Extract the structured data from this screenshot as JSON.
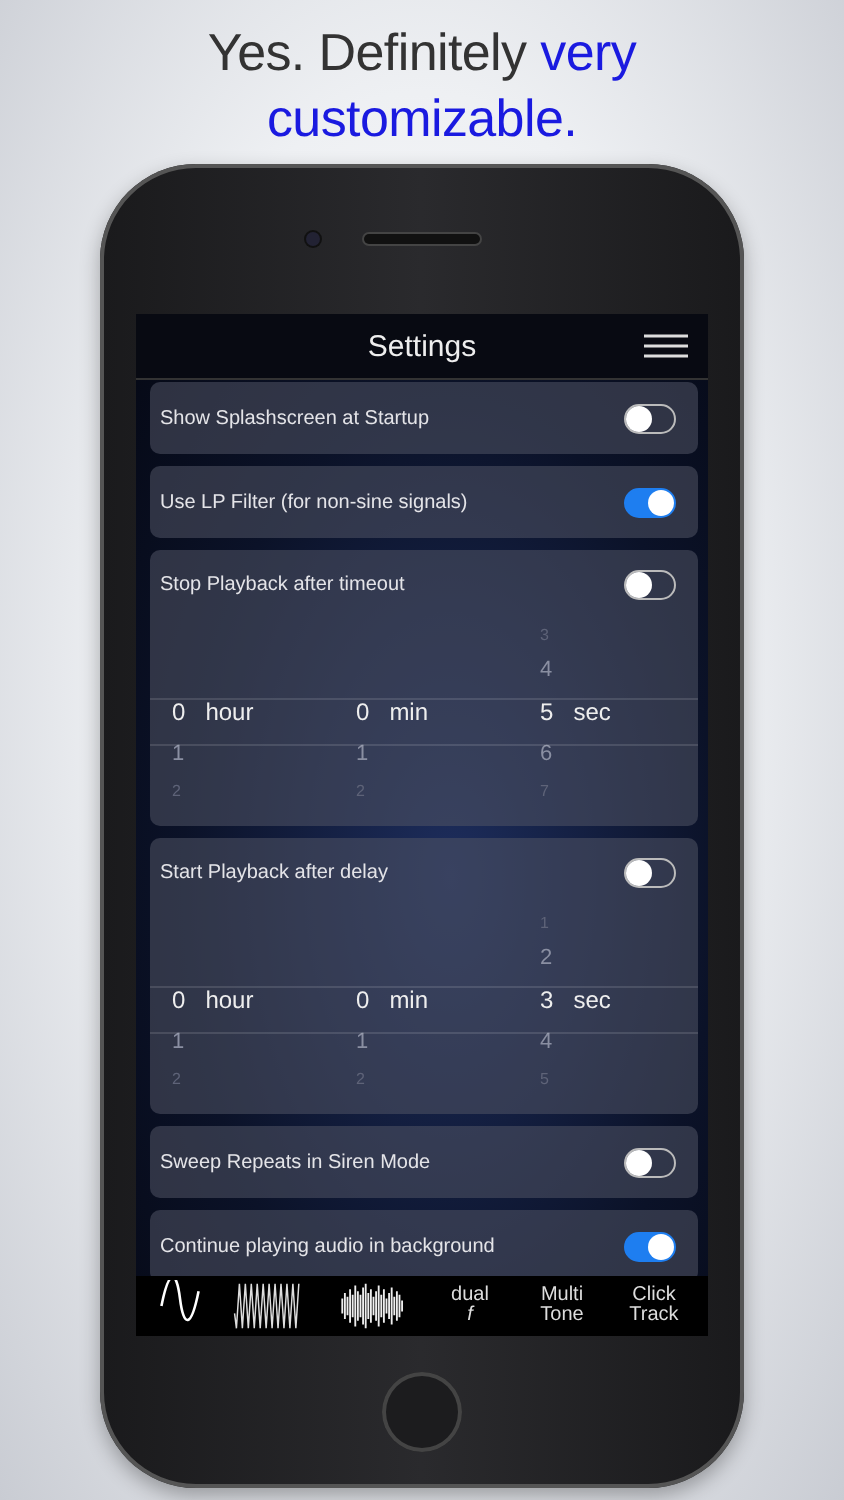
{
  "headline": {
    "text": "Yes. Definitely ",
    "highlight": "very customizable."
  },
  "screen": {
    "title": "Settings",
    "settings": [
      {
        "kind": "switch",
        "label": "Show Splashscreen at Startup",
        "on": false
      },
      {
        "kind": "switch",
        "label": "Use LP Filter (for non-sine signals)",
        "on": true
      },
      {
        "kind": "timer",
        "label": "Stop Playback after timeout",
        "on": false,
        "columns": [
          {
            "value": "0",
            "unit": "hour",
            "below": [
              "1",
              "2"
            ]
          },
          {
            "value": "0",
            "unit": "min",
            "below": [
              "1",
              "2"
            ]
          },
          {
            "above": [
              "3",
              "4"
            ],
            "value": "5",
            "unit": "sec",
            "below": [
              "6",
              "7"
            ]
          }
        ]
      },
      {
        "kind": "timer",
        "label": "Start Playback after delay",
        "on": false,
        "columns": [
          {
            "value": "0",
            "unit": "hour",
            "below": [
              "1",
              "2"
            ]
          },
          {
            "value": "0",
            "unit": "min",
            "below": [
              "1",
              "2"
            ]
          },
          {
            "above": [
              "1",
              "2"
            ],
            "value": "3",
            "unit": "sec",
            "below": [
              "4",
              "5"
            ]
          }
        ]
      },
      {
        "kind": "switch",
        "label": "Sweep Repeats in Siren Mode",
        "on": false
      },
      {
        "kind": "switch",
        "label": "Continue playing audio in background",
        "on": true
      }
    ],
    "tabs": [
      {
        "kind": "sine"
      },
      {
        "kind": "sweep"
      },
      {
        "kind": "noise"
      },
      {
        "kind": "text",
        "label": "dual *f*"
      },
      {
        "kind": "text",
        "label": "Multi Tone"
      },
      {
        "kind": "text",
        "label": "Click Track"
      }
    ]
  }
}
